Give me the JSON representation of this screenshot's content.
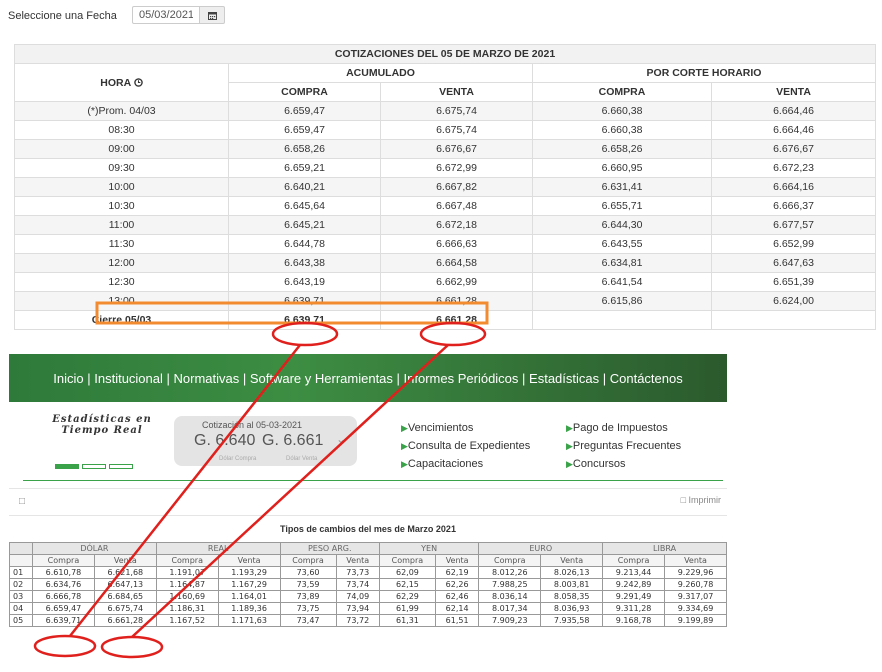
{
  "date_picker": {
    "label": "Seleccione una Fecha",
    "value": "05/03/2021",
    "icon": "calendar-icon"
  },
  "quotes_table": {
    "title": "COTIZACIONES DEL 05 DE MARZO DE 2021",
    "hour_header": "HORA",
    "hour_icon": "clock-icon",
    "group_acumulado": "ACUMULADO",
    "group_corte": "POR CORTE HORARIO",
    "col_compra": "COMPRA",
    "col_venta": "VENTA",
    "rows": [
      {
        "hora": "(*)Prom. 04/03",
        "acum_compra": "6.659,47",
        "acum_venta": "6.675,74",
        "corte_compra": "6.660,38",
        "corte_venta": "6.664,46"
      },
      {
        "hora": "08:30",
        "acum_compra": "6.659,47",
        "acum_venta": "6.675,74",
        "corte_compra": "6.660,38",
        "corte_venta": "6.664,46"
      },
      {
        "hora": "09:00",
        "acum_compra": "6.658,26",
        "acum_venta": "6.676,67",
        "corte_compra": "6.658,26",
        "corte_venta": "6.676,67"
      },
      {
        "hora": "09:30",
        "acum_compra": "6.659,21",
        "acum_venta": "6.672,99",
        "corte_compra": "6.660,95",
        "corte_venta": "6.672,23"
      },
      {
        "hora": "10:00",
        "acum_compra": "6.640,21",
        "acum_venta": "6.667,82",
        "corte_compra": "6.631,41",
        "corte_venta": "6.664,16"
      },
      {
        "hora": "10:30",
        "acum_compra": "6.645,64",
        "acum_venta": "6.667,48",
        "corte_compra": "6.655,71",
        "corte_venta": "6.666,37"
      },
      {
        "hora": "11:00",
        "acum_compra": "6.645,21",
        "acum_venta": "6.672,18",
        "corte_compra": "6.644,30",
        "corte_venta": "6.677,57"
      },
      {
        "hora": "11:30",
        "acum_compra": "6.644,78",
        "acum_venta": "6.666,63",
        "corte_compra": "6.643,55",
        "corte_venta": "6.652,99"
      },
      {
        "hora": "12:00",
        "acum_compra": "6.643,38",
        "acum_venta": "6.664,58",
        "corte_compra": "6.634,81",
        "corte_venta": "6.647,63"
      },
      {
        "hora": "12:30",
        "acum_compra": "6.643,19",
        "acum_venta": "6.662,99",
        "corte_compra": "6.641,54",
        "corte_venta": "6.651,39"
      },
      {
        "hora": "13:00",
        "acum_compra": "6.639,71",
        "acum_venta": "6.661,28",
        "corte_compra": "6.615,86",
        "corte_venta": "6.624,00"
      }
    ],
    "close": {
      "label": "Cierre 05/03",
      "compra": "6.639,71",
      "venta": "6.661,28"
    }
  },
  "embedded_site": {
    "nav": [
      "Inicio",
      "Institucional",
      "Normativas",
      "Software y Herramientas",
      "Informes Periódicos",
      "Estadísticas",
      "Contáctenos"
    ],
    "stats_title_1": "Estadísticas en",
    "stats_title_2": "Tiempo Real",
    "cotizacion": {
      "title": "Cotización al 05-03-2021",
      "compra": "G. 6.640",
      "venta": "G. 6.661",
      "compra_label": "Dólar Compra",
      "venta_label": "Dólar Venta"
    },
    "links_left": [
      "Vencimientos",
      "Consulta de Expedientes",
      "Capacitaciones"
    ],
    "links_right": [
      "Pago de Impuestos",
      "Preguntas Frecuentes",
      "Concursos"
    ],
    "print_label": "Imprimir",
    "monthly_title": "Tipos de cambios del mes de Marzo 2021",
    "currencies": [
      "DÓLAR",
      "REAL",
      "PESO ARG.",
      "YEN",
      "EURO",
      "LIBRA"
    ],
    "sub_compra": "Compra",
    "sub_venta": "Venta",
    "monthly_rows": [
      {
        "day": "01",
        "values": [
          "6.610,78",
          "6.621,68",
          "1.191,07",
          "1.193,29",
          "73,60",
          "73,73",
          "62,09",
          "62,19",
          "8.012,26",
          "8.026,13",
          "9.213,44",
          "9.229,96"
        ]
      },
      {
        "day": "02",
        "values": [
          "6.634,76",
          "6.647,13",
          "1.164,87",
          "1.167,29",
          "73,59",
          "73,74",
          "62,15",
          "62,26",
          "7.988,25",
          "8.003,81",
          "9.242,89",
          "9.260,78"
        ]
      },
      {
        "day": "03",
        "values": [
          "6.666,78",
          "6.684,65",
          "1.160,69",
          "1.164,01",
          "73,89",
          "74,09",
          "62,29",
          "62,46",
          "8.036,14",
          "8.058,35",
          "9.291,49",
          "9.317,07"
        ]
      },
      {
        "day": "04",
        "values": [
          "6.659,47",
          "6.675,74",
          "1.186,31",
          "1.189,36",
          "73,75",
          "73,94",
          "61,99",
          "62,14",
          "8.017,34",
          "8.036,93",
          "9.311,28",
          "9.334,69"
        ]
      },
      {
        "day": "05",
        "values": [
          "6.639,71",
          "6.661,28",
          "1.167,52",
          "1.171,63",
          "73,47",
          "73,72",
          "61,31",
          "61,51",
          "7.909,23",
          "7.935,58",
          "9.168,78",
          "9.199,89"
        ]
      }
    ]
  },
  "annotation_colors": {
    "highlight_box": "#f28a30",
    "circles": "#e0201c"
  }
}
